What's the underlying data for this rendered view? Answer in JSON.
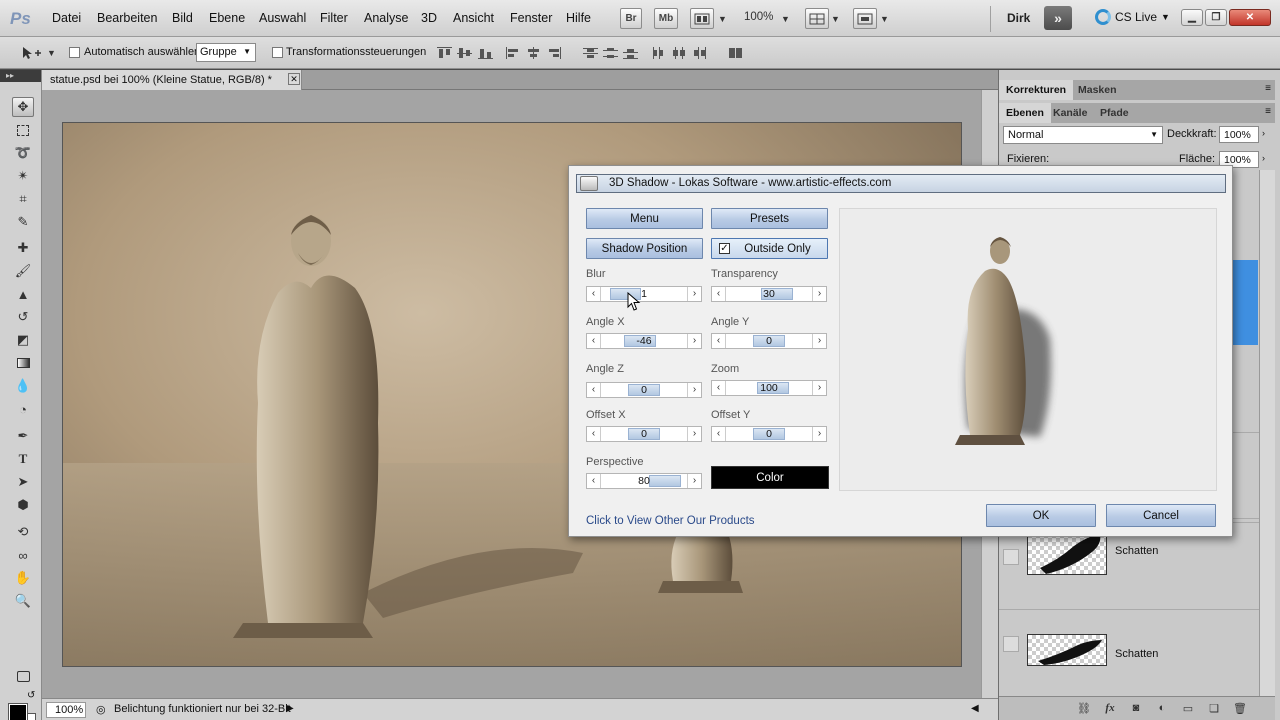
{
  "app": {
    "logo": "Ps",
    "menu": [
      "Datei",
      "Bearbeiten",
      "Bild",
      "Ebene",
      "Auswahl",
      "Filter",
      "Analyse",
      "3D",
      "Ansicht",
      "Fenster",
      "Hilfe"
    ],
    "bridge_label": "Br",
    "minibridge_label": "Mb",
    "zoom_level": "100%",
    "workspace_user": "Dirk",
    "cs_live": "CS Live",
    "expand_label": "»"
  },
  "options_bar": {
    "auto_select_label": "Automatisch auswählen:",
    "auto_select_value": "Gruppe",
    "transform_controls_label": "Transformationssteuerungen"
  },
  "document": {
    "tab_title": "statue.psd bei 100% (Kleine Statue, RGB/8) *",
    "status_zoom": "100%",
    "status_text": "Belichtung funktioniert nur bei 32-Bit"
  },
  "panels": {
    "top_tabs": [
      "Korrekturen",
      "Masken"
    ],
    "layer_tabs": [
      "Ebenen",
      "Kanäle",
      "Pfade"
    ],
    "blend_mode": "Normal",
    "opacity_label": "Deckkraft:",
    "opacity_value": "100%",
    "lock_label": "Fixieren:",
    "fill_label": "Fläche:",
    "fill_value": "100%",
    "layers": [
      {
        "name": "Schatten"
      },
      {
        "name": "Schatten"
      }
    ],
    "footer_fx": "fx"
  },
  "dialog": {
    "title": "3D Shadow - Lokas Software - www.artistic-effects.com",
    "menu_button": "Menu",
    "presets_button": "Presets",
    "shadow_position_button": "Shadow Position",
    "outside_only_label": "Outside Only",
    "outside_only_checked": true,
    "params": [
      {
        "label": "Blur",
        "value": "1",
        "fraction": 0.28
      },
      {
        "label": "Transparency",
        "value": "30",
        "fraction": 0.6
      },
      {
        "label": "Angle X",
        "value": "-46",
        "fraction": 0.45
      },
      {
        "label": "Angle Y",
        "value": "0",
        "fraction": 0.5
      },
      {
        "label": "Angle Z",
        "value": "0",
        "fraction": 0.5
      },
      {
        "label": "Zoom",
        "value": "100",
        "fraction": 0.55
      },
      {
        "label": "Offset X",
        "value": "0",
        "fraction": 0.5
      },
      {
        "label": "Offset Y",
        "value": "0",
        "fraction": 0.5
      },
      {
        "label": "Perspective",
        "value": "80",
        "fraction": 0.75
      }
    ],
    "color_button": "Color",
    "color_value": "#000000",
    "products_link": "Click to View Other Our Products",
    "ok_button": "OK",
    "cancel_button": "Cancel"
  },
  "colors": {
    "dialog_button": "#b9cbe5",
    "link": "#2a4a8a",
    "canvas_sepia": "#b09a7c"
  }
}
